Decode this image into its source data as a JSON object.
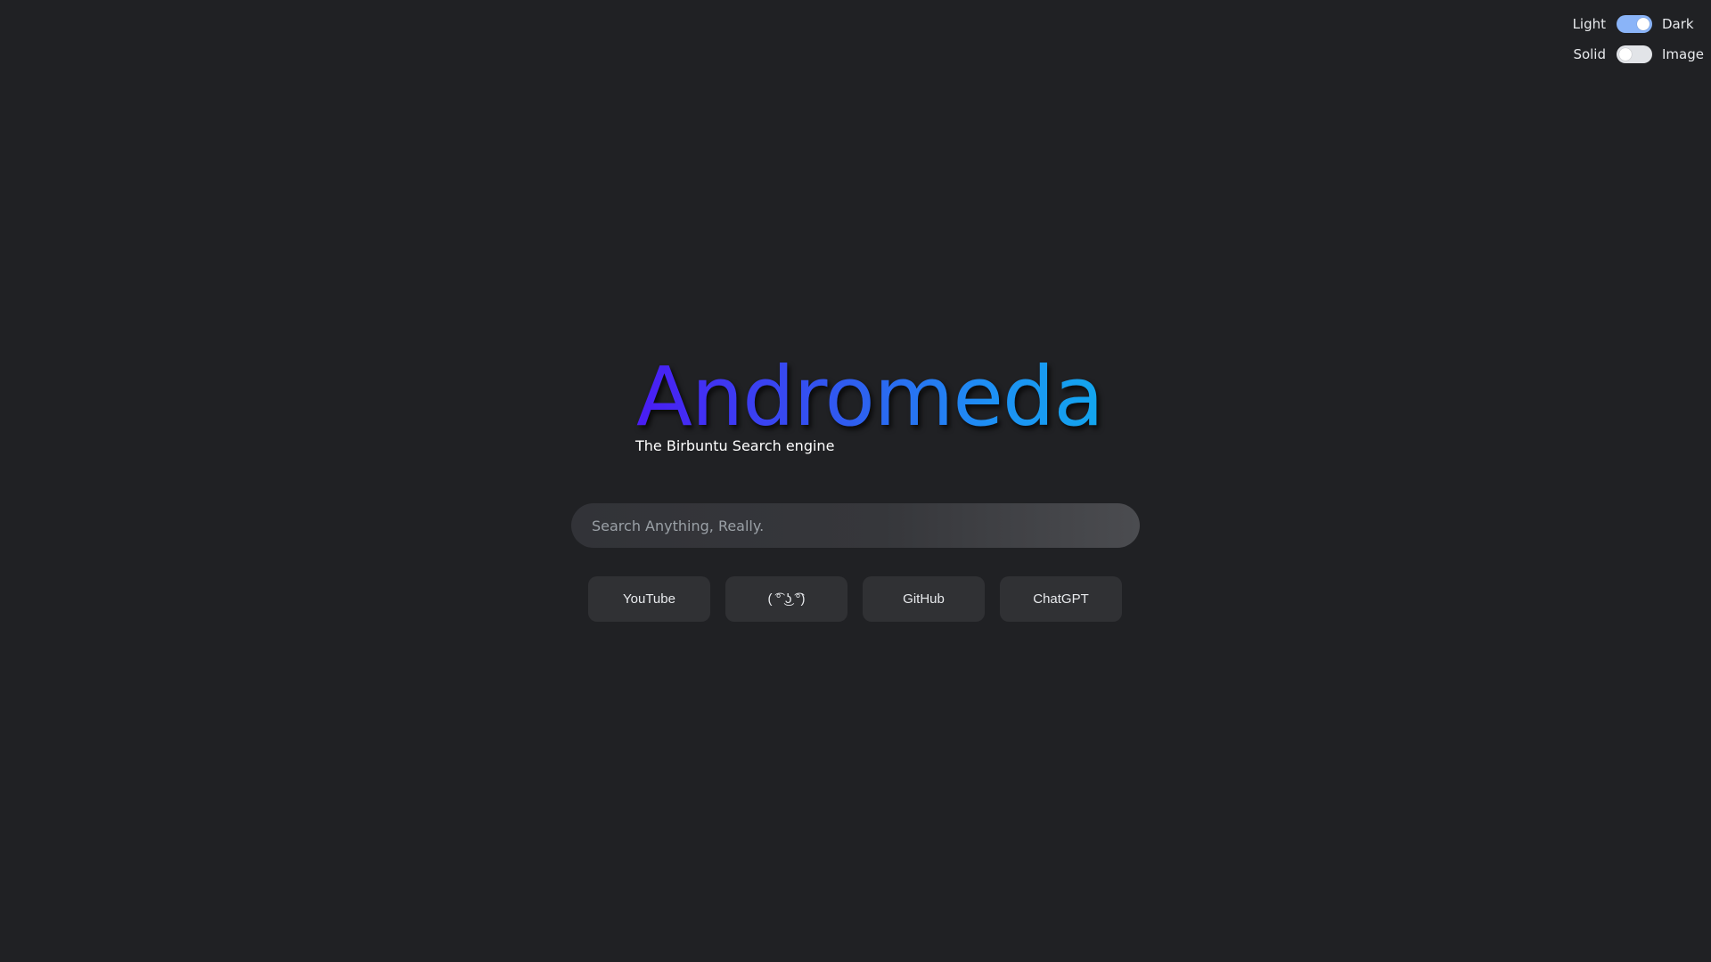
{
  "settings": {
    "theme_toggle": {
      "left_label": "Light",
      "right_label": "Dark",
      "state": "Dark"
    },
    "background_toggle": {
      "left_label": "Solid",
      "right_label": "Image",
      "state": "Solid"
    }
  },
  "brand": {
    "logo_text": "Andromeda",
    "tagline": "The Birbuntu Search engine",
    "gradient_colors": [
      "#4a1cf4",
      "#2f5cf0",
      "#1e8ff4",
      "#12a6ee"
    ]
  },
  "search": {
    "placeholder": "Search Anything, Really.",
    "value": ""
  },
  "shortcuts": [
    {
      "label": "YouTube"
    },
    {
      "label": "( ͡° ͜ʖ ͡°)"
    },
    {
      "label": "GitHub"
    },
    {
      "label": "ChatGPT"
    }
  ],
  "colors": {
    "background": "#202124",
    "toggle_on": "#8ab4f8",
    "toggle_off": "#e2e4e8",
    "button_bg": "#303134"
  }
}
